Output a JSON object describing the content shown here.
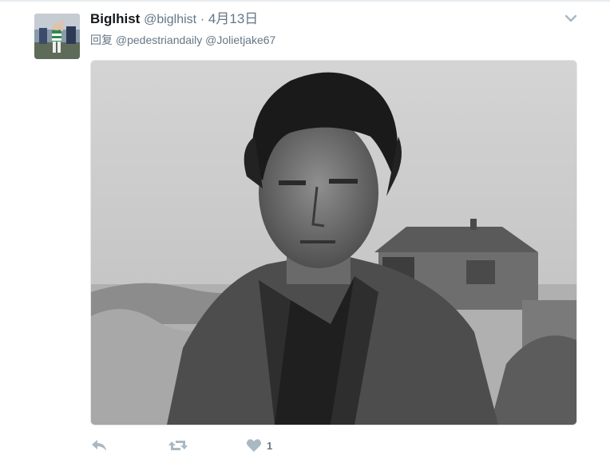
{
  "tweet": {
    "fullname": "Biglhist",
    "handle": "@biglhist",
    "separator": "·",
    "time": "4月13日",
    "reply_prefix": "回复",
    "reply_mentions": [
      "@pedestriandaily",
      "@Jolietjake67"
    ],
    "like_count": "1"
  },
  "icons": {
    "caret": "chevron-down-icon",
    "reply": "reply-icon",
    "retweet": "retweet-icon",
    "like": "heart-icon"
  },
  "colors": {
    "secondary_text": "#657786",
    "icon_gray": "#aab8c2"
  }
}
